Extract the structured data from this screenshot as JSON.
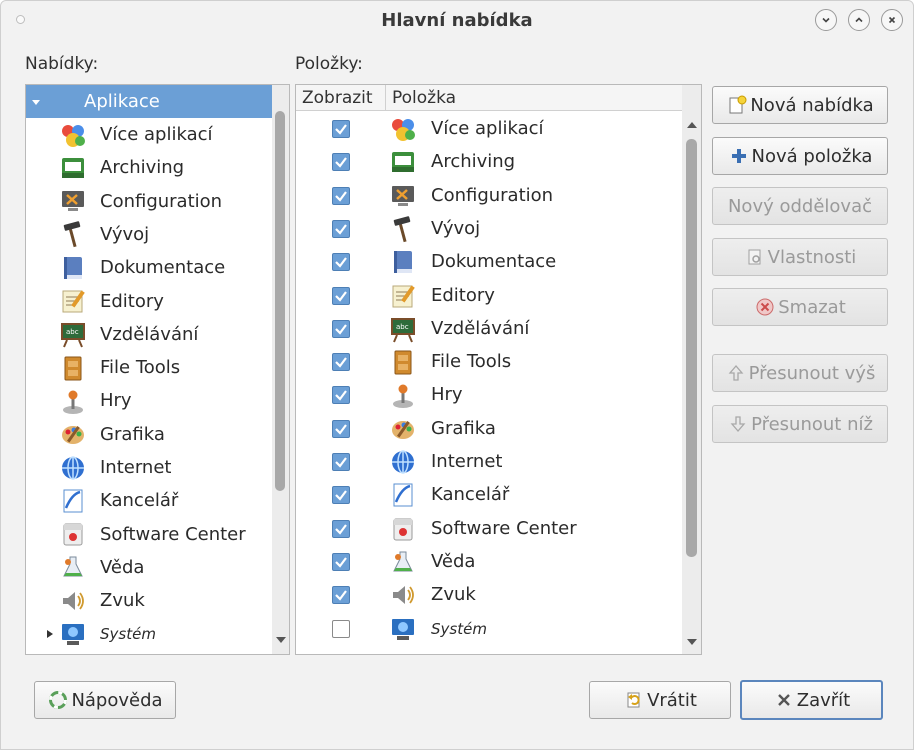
{
  "window": {
    "title": "Hlavní nabídka"
  },
  "left_panel": {
    "label": "Nabídky:",
    "root": {
      "label": "Aplikace",
      "expanded": true
    },
    "items": [
      {
        "label": "Více aplikací",
        "icon": "more-apps-icon"
      },
      {
        "label": "Archiving",
        "icon": "archive-icon"
      },
      {
        "label": "Configuration",
        "icon": "configuration-icon"
      },
      {
        "label": "Vývoj",
        "icon": "hammer-icon"
      },
      {
        "label": "Dokumentace",
        "icon": "book-icon"
      },
      {
        "label": "Editory",
        "icon": "notepad-icon"
      },
      {
        "label": "Vzdělávání",
        "icon": "chalkboard-icon"
      },
      {
        "label": "File Tools",
        "icon": "cabinet-icon"
      },
      {
        "label": "Hry",
        "icon": "joystick-icon"
      },
      {
        "label": "Grafika",
        "icon": "palette-icon"
      },
      {
        "label": "Internet",
        "icon": "globe-icon"
      },
      {
        "label": "Kancelář",
        "icon": "office-icon"
      },
      {
        "label": "Software Center",
        "icon": "software-center-icon"
      },
      {
        "label": "Věda",
        "icon": "science-icon"
      },
      {
        "label": "Zvuk",
        "icon": "speaker-icon"
      },
      {
        "label": "Systém",
        "icon": "system-icon",
        "italic": true,
        "collapsed": true
      }
    ]
  },
  "right_panel": {
    "label": "Položky:",
    "col_show": "Zobrazit",
    "col_item": "Položka",
    "items": [
      {
        "label": "Více aplikací",
        "icon": "more-apps-icon",
        "checked": true
      },
      {
        "label": "Archiving",
        "icon": "archive-icon",
        "checked": true
      },
      {
        "label": "Configuration",
        "icon": "configuration-icon",
        "checked": true
      },
      {
        "label": "Vývoj",
        "icon": "hammer-icon",
        "checked": true
      },
      {
        "label": "Dokumentace",
        "icon": "book-icon",
        "checked": true
      },
      {
        "label": "Editory",
        "icon": "notepad-icon",
        "checked": true
      },
      {
        "label": "Vzdělávání",
        "icon": "chalkboard-icon",
        "checked": true
      },
      {
        "label": "File Tools",
        "icon": "cabinet-icon",
        "checked": true
      },
      {
        "label": "Hry",
        "icon": "joystick-icon",
        "checked": true
      },
      {
        "label": "Grafika",
        "icon": "palette-icon",
        "checked": true
      },
      {
        "label": "Internet",
        "icon": "globe-icon",
        "checked": true
      },
      {
        "label": "Kancelář",
        "icon": "office-icon",
        "checked": true
      },
      {
        "label": "Software Center",
        "icon": "software-center-icon",
        "checked": true
      },
      {
        "label": "Věda",
        "icon": "science-icon",
        "checked": true
      },
      {
        "label": "Zvuk",
        "icon": "speaker-icon",
        "checked": true
      },
      {
        "label": "Systém",
        "icon": "system-icon",
        "checked": false,
        "italic": true
      }
    ]
  },
  "buttons": {
    "new_menu": "Nová nabídka",
    "new_item": "Nová položka",
    "new_separator": "Nový oddělovač",
    "properties": "Vlastnosti",
    "delete": "Smazat",
    "move_up": "Přesunout výš",
    "move_down": "Přesunout níž",
    "help": "Nápověda",
    "revert": "Vrátit",
    "close": "Zavřít"
  },
  "colors": {
    "selection": "#6b9fd6",
    "default_button_border": "#5b86bd"
  }
}
